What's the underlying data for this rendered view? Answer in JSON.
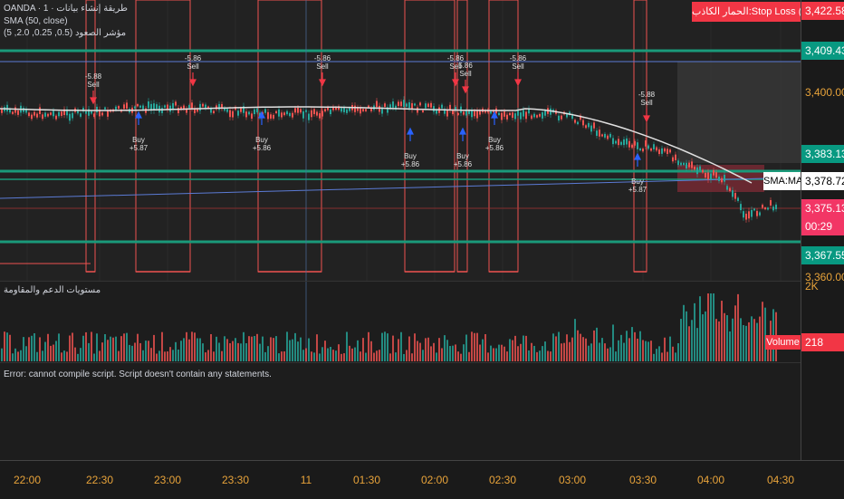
{
  "header": {
    "symbol_line": "OANDA · 1 · طريقة إنشاء بيانات",
    "sma_line": "SMA (50, close)",
    "indicator_line": "مؤشر الصعود (0.5, 0.25, 2.0, 5)"
  },
  "alert": {
    "stop_loss_label": "الحمار الكاذب:Stop Loss (Buy)"
  },
  "price_axis": {
    "labels": [
      {
        "text": "3,422.58",
        "style": "red"
      },
      {
        "text": "3,409.43",
        "style": "green"
      },
      {
        "text": "3,400.00",
        "style": "plain"
      },
      {
        "text": "3,383.13",
        "style": "green"
      },
      {
        "text": "3,378.72",
        "style": "white"
      },
      {
        "text": "3,375.13",
        "style": "pink"
      },
      {
        "text": "00:29",
        "style": "pink"
      },
      {
        "text": "3,367.55",
        "style": "green"
      },
      {
        "text": "3,360.00",
        "style": "plain"
      },
      {
        "text": "2K",
        "style": "plain"
      },
      {
        "text": "218",
        "style": "red"
      }
    ]
  },
  "sma_box_label": "SMA:MA",
  "volume": {
    "label": "Volume",
    "value": "218",
    "pane_title": "مستويات الدعم والمقاومة"
  },
  "error_message": "Error: cannot compile script. Script doesn't contain any statements.",
  "time_axis": {
    "ticks": [
      "22:00",
      "22:30",
      "23:00",
      "23:30",
      "11",
      "01:30",
      "02:00",
      "02:30",
      "03:00",
      "03:30",
      "04:00",
      "04:30"
    ]
  },
  "signals": [
    {
      "kind": "sell",
      "label": "-5.88",
      "word": "Sell"
    },
    {
      "kind": "buy",
      "label": "+5.87",
      "word": "Buy"
    },
    {
      "kind": "sell",
      "label": "-5.86",
      "word": "Sell"
    },
    {
      "kind": "buy",
      "label": "+5.86",
      "word": "Buy"
    },
    {
      "kind": "sell",
      "label": "-5.86",
      "word": "Sell"
    },
    {
      "kind": "buy",
      "label": "+5.86",
      "word": "Buy"
    },
    {
      "kind": "sell",
      "label": "-5.86",
      "word": "Sell"
    },
    {
      "kind": "sell",
      "label": "5.86",
      "word": "Sell"
    },
    {
      "kind": "buy",
      "label": "+5.86",
      "word": "Buy"
    },
    {
      "kind": "buy",
      "label": "+5.86",
      "word": "Buy"
    },
    {
      "kind": "sell",
      "label": "-5.86",
      "word": "Sell"
    },
    {
      "kind": "sell",
      "label": "-5.88",
      "word": "Sell"
    },
    {
      "kind": "buy",
      "label": "+5.87",
      "word": "Buy"
    }
  ],
  "colors": {
    "bull": "#26a69a",
    "bear": "#ef5350",
    "level_green": "#1a9a7a",
    "level_blue": "#5b7bd5",
    "sma": "#e0e0e0",
    "axis_text": "#e8a33a"
  }
}
